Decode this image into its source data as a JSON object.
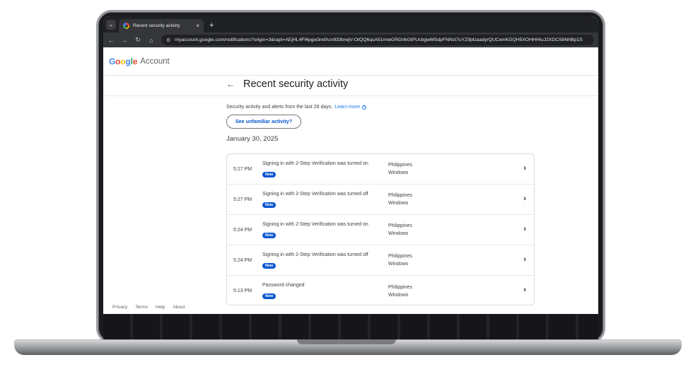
{
  "browser": {
    "tab_title": "Recent security activity",
    "tab_close": "×",
    "new_tab": "+",
    "url": "myaccount.google.com/notifications?origin=3&rapt=AEjHL4Fl4pgw3refAcv933tvwjV-OtQQ6qsA51nneGRGrlkGtPUcbgwMSdpFNNst7uYZ9plzaadyrQUCwnKGQH5XOHHHIuJ2XDCS8NhBp1S"
  },
  "page": {
    "brand": "Account",
    "title": "Recent security activity",
    "intro": "Security activity and alerts from the last 28 days.",
    "learn_more": "Learn more",
    "unfamiliar_button": "See unfamiliar activity?",
    "date_heading": "January 30, 2025"
  },
  "activities": [
    {
      "time": "5:27 PM",
      "event": "Signing in with 2-Step Verification was turned on",
      "badge": "New",
      "location": "Philippines",
      "device": "Windows"
    },
    {
      "time": "5:27 PM",
      "event": "Signing in with 2-Step Verification was turned off",
      "badge": "New",
      "location": "Philippines",
      "device": "Windows"
    },
    {
      "time": "5:24 PM",
      "event": "Signing in with 2-Step Verification was turned on",
      "badge": "New",
      "location": "Philippines",
      "device": "Windows"
    },
    {
      "time": "5:24 PM",
      "event": "Signing in with 2-Step Verification was turned off",
      "badge": "New",
      "location": "Philippines",
      "device": "Windows"
    },
    {
      "time": "5:13 PM",
      "event": "Password changed",
      "badge": "New",
      "location": "Philippines",
      "device": "Windows"
    }
  ],
  "footer": {
    "privacy": "Privacy",
    "terms": "Terms",
    "help": "Help",
    "about": "About"
  },
  "icons": {
    "back": "arrow-left-icon",
    "forward": "arrow-right-icon",
    "reload": "reload-icon",
    "home": "home-icon",
    "chevron": "chevron-right-icon"
  },
  "colors": {
    "accent": "#0b57d0",
    "link": "#1a73e8",
    "browser_dark": "#202124"
  }
}
